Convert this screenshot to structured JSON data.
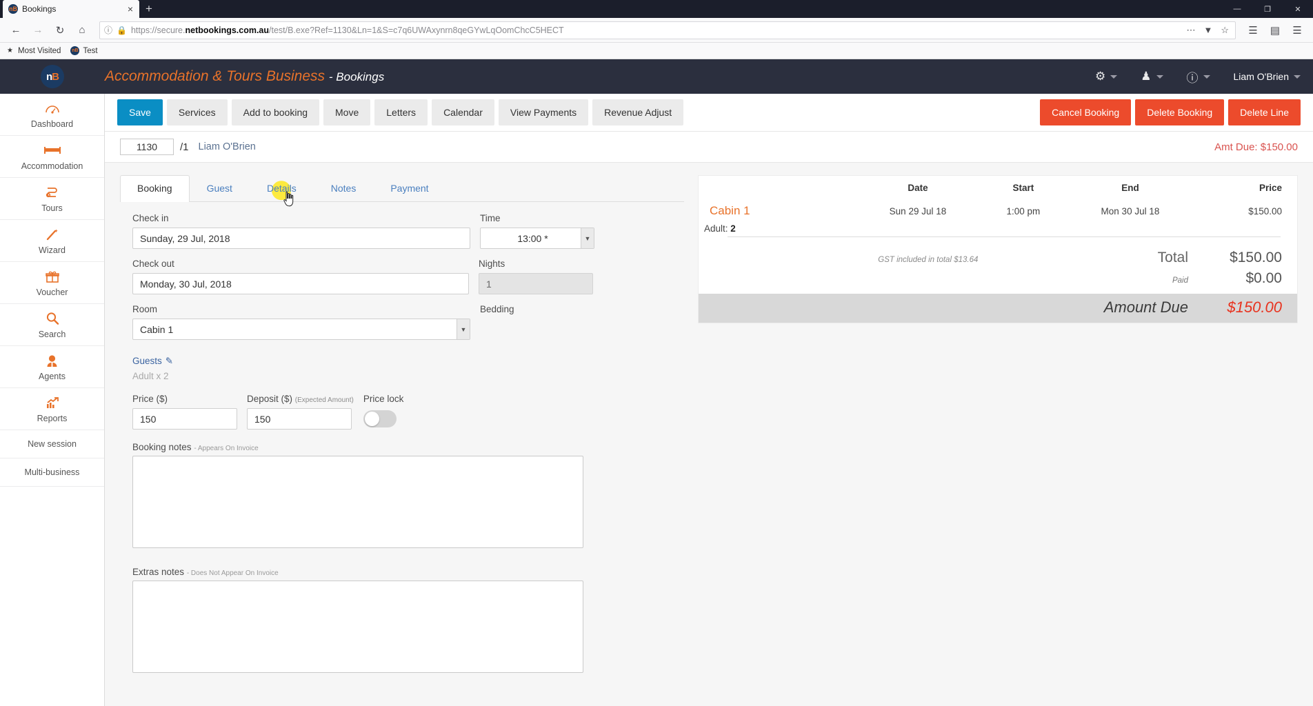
{
  "browser": {
    "tab": {
      "title": "Bookings",
      "favicon": "nb",
      "close_label": "×"
    },
    "newtab_label": "+",
    "window_controls": {
      "minimize": "—",
      "maximize": "❐",
      "close": "✕"
    },
    "nav": {
      "back": "←",
      "forward": "→",
      "reload": "↻",
      "home": "⌂",
      "url_prefix": "https://secure.",
      "url_domain": "netbookings.com.au",
      "url_path": "/test/B.exe?Ref=1130&Ln=1&S=c7q6UWAxynrn8qeGYwLqOomChcC5HECT",
      "info_icon": "ⓘ",
      "lock_icon": "ὑ2",
      "menu_dots": "⋯",
      "pocket": "▼",
      "star": "☆",
      "library": "☰",
      "sidebars": "▤",
      "hamburger": "☰"
    },
    "bookmarks": [
      {
        "label": "Most Visited",
        "icon": "star-icon"
      },
      {
        "label": "Test",
        "icon": "nb-icon"
      }
    ]
  },
  "app_header": {
    "logo_n": "n",
    "logo_b": "B",
    "business_name": "Accommodation & Tours Business",
    "section": "- Bookings",
    "icons": [
      {
        "name": "settings-gears-icon",
        "glyph": "⚙"
      },
      {
        "name": "user-kettle-icon",
        "glyph": "♟"
      },
      {
        "name": "help-icon",
        "glyph": "?"
      }
    ],
    "user": "Liam O'Brien"
  },
  "sidebar": {
    "items": [
      {
        "label": "Dashboard",
        "icon": "dashboard-gauge-icon",
        "glyph": "◔"
      },
      {
        "label": "Accommodation",
        "icon": "bed-icon",
        "glyph": "Ὤf"
      },
      {
        "label": "Tours",
        "icon": "route-icon",
        "glyph": "⇝"
      },
      {
        "label": "Wizard",
        "icon": "magic-wand-icon",
        "glyph": "✦"
      },
      {
        "label": "Voucher",
        "icon": "gift-icon",
        "glyph": "Ἰ1"
      },
      {
        "label": "Search",
        "icon": "magnifier-icon",
        "glyph": "ὐd"
      },
      {
        "label": "Agents",
        "icon": "agent-person-icon",
        "glyph": "὆4"
      },
      {
        "label": "Reports",
        "icon": "chart-up-icon",
        "glyph": "Ὄ8"
      }
    ],
    "plain_items": [
      {
        "label": "New session"
      },
      {
        "label": "Multi-business"
      }
    ]
  },
  "toolbar": {
    "left_buttons": [
      {
        "label": "Save",
        "style": "primary"
      },
      {
        "label": "Services",
        "style": "default"
      },
      {
        "label": "Add to booking",
        "style": "default"
      },
      {
        "label": "Move",
        "style": "default"
      },
      {
        "label": "Letters",
        "style": "default"
      },
      {
        "label": "Calendar",
        "style": "default"
      },
      {
        "label": "View Payments",
        "style": "default"
      },
      {
        "label": "Revenue Adjust",
        "style": "default"
      }
    ],
    "right_buttons": [
      {
        "label": "Cancel Booking"
      },
      {
        "label": "Delete Booking"
      },
      {
        "label": "Delete Line"
      }
    ]
  },
  "refbar": {
    "ref_value": "1130",
    "line": "/1",
    "guest_name": "Liam O'Brien",
    "amount_due_label": "Amt Due: $150.00"
  },
  "tabs": [
    {
      "label": "Booking",
      "active": true
    },
    {
      "label": "Guest",
      "active": false
    },
    {
      "label": "Details",
      "active": false,
      "hovered": true
    },
    {
      "label": "Notes",
      "active": false
    },
    {
      "label": "Payment",
      "active": false
    }
  ],
  "form": {
    "check_in": {
      "label": "Check in",
      "value": "Sunday, 29 Jul, 2018"
    },
    "time": {
      "label": "Time",
      "value": "13:00 *"
    },
    "check_out": {
      "label": "Check out",
      "value": "Monday, 30 Jul, 2018"
    },
    "nights": {
      "label": "Nights",
      "value": "1"
    },
    "room": {
      "label": "Room",
      "value": "Cabin 1"
    },
    "bedding": {
      "label": "Bedding",
      "value": ""
    },
    "guests": {
      "label": "Guests",
      "edit_icon": "✎",
      "summary": "Adult x 2"
    },
    "price": {
      "label": "Price ($)",
      "value": "150"
    },
    "deposit": {
      "label": "Deposit ($)",
      "note": "(Expected Amount)",
      "value": "150"
    },
    "price_lock": {
      "label": "Price lock",
      "state": "off"
    },
    "booking_notes": {
      "label": "Booking notes",
      "note": "- Appears On Invoice",
      "value": ""
    },
    "extras_notes": {
      "label": "Extras notes",
      "note": "- Does Not Appear On Invoice",
      "value": ""
    }
  },
  "summary": {
    "headers": {
      "item": "",
      "date": "Date",
      "start": "Start",
      "end": "End",
      "price": "Price"
    },
    "lines": [
      {
        "room": "Cabin 1",
        "date": "Sun 29 Jul 18",
        "start": "1:00 pm",
        "end": "Mon 30 Jul 18",
        "price": "$150.00",
        "guests_label": "Adult:",
        "guests_count": "2"
      }
    ],
    "gst_note": "GST included in total $13.64",
    "total_label": "Total",
    "total_value": "$150.00",
    "paid_label": "Paid",
    "paid_value": "$0.00",
    "due_label": "Amount Due",
    "due_value": "$150.00"
  },
  "colors": {
    "brand_orange": "#e8722a",
    "header_dark": "#2b2f3e",
    "primary_blue": "#0a8ec4",
    "danger_red": "#ec4b2c",
    "due_red": "#e8331f",
    "link_blue": "#4a7fbf"
  }
}
